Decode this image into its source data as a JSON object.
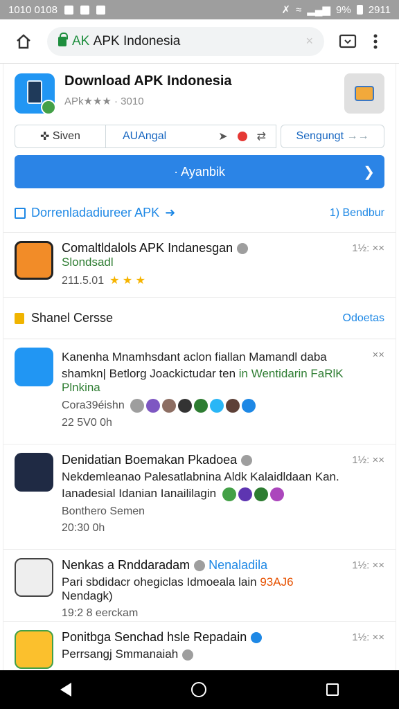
{
  "status_bar": {
    "time_left": "1010 0108",
    "battery": "9%",
    "clock": "2911"
  },
  "browser": {
    "url_green": "AK",
    "url_rest": "APK Indonesia"
  },
  "app": {
    "title": "Download APK Indonesia",
    "subtitle": "APk★★★ · 3010"
  },
  "filters": {
    "seg1": "Siven",
    "seg2": "AUAngal",
    "seg3": "Sengungt"
  },
  "primary_button": {
    "label": "· Ayanbik"
  },
  "section": {
    "title": "Dorrenladadiureer APK",
    "right": "1) Bendbur"
  },
  "featured": {
    "title": "Comaltldalols APK Indanesgan",
    "green": "Slondsadl",
    "meta": "211.5.01",
    "time": "1½: ××"
  },
  "subhead": {
    "title": "Shanel Cersse",
    "right": "Odoetas"
  },
  "items": [
    {
      "line1": "Kanenha Mnamhsdant aclon fiallan Mamandl daba",
      "line2": "shamkn| Betlorg Joackictudar ten",
      "line2_green": "in Wentidarin FaRlK",
      "line3": "Plnkina",
      "meta": "Cora39éishn",
      "sub": "22 5V0 0h",
      "time": "××"
    },
    {
      "line1": "Denidatian Boemakan Pkadoea",
      "line2": "Nekdemleanao Palesatlabnina Aldk Kalaidldaan Kan.",
      "line3": "Ianadesial Idanian Ianaililagin",
      "meta": "Bonthero Semen",
      "sub": "20:30 0h",
      "time": "1½: ××"
    },
    {
      "line1": "Nenkas a Rnddaradam",
      "line1_blue": "Nenaladila",
      "line2": "Pari sbdidacr ohegiclas Idmoeala lain",
      "line2_orange": "93AJ6",
      "line2_end": "Nendagk)",
      "meta": "19:2 8 eerckam",
      "time": "1½: ××"
    },
    {
      "line1": "Ponitbga Senchad hsle Repadain",
      "line2": "Perrsangj Smmanaiah",
      "time": "1½: ××"
    }
  ]
}
